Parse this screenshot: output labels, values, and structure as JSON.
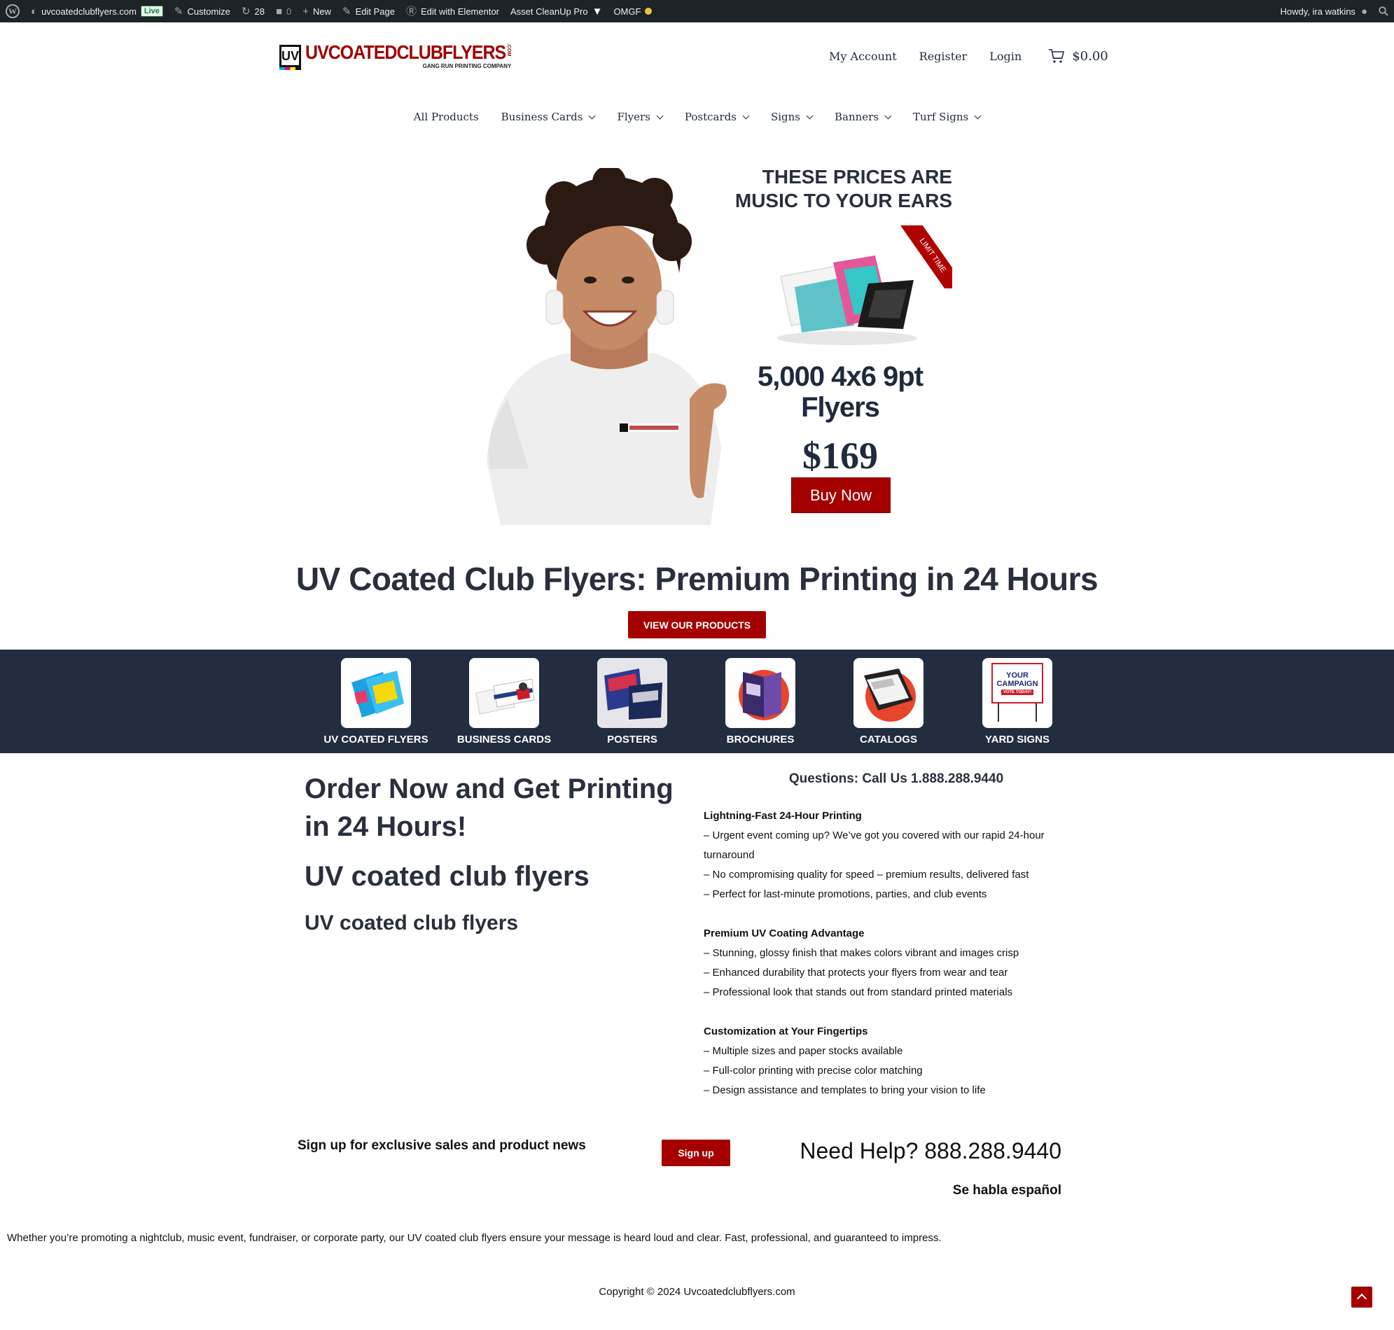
{
  "admin_bar": {
    "site_name": "uvcoatedclubflyers.com",
    "live_badge": "Live",
    "customize": "Customize",
    "updates_count": "28",
    "comments_count": "0",
    "new": "New",
    "edit_page": "Edit Page",
    "edit_elementor": "Edit with Elementor",
    "asset_cleanup": "Asset CleanUp Pro",
    "omgf": "OMGF",
    "greeting": "Howdy, ira watkins",
    "icons": [
      "wordpress-icon",
      "dashboard-icon",
      "brush-icon",
      "refresh-icon",
      "comment-icon",
      "plus-icon",
      "pencil-icon",
      "elementor-icon",
      "filter-icon",
      "user-icon",
      "search-icon"
    ]
  },
  "logo": {
    "badge": "UV",
    "main": "UVCOATEDCLUBFLYERS",
    "dotcom": ".COM",
    "tagline": "GANG RUN PRINTING COMPANY"
  },
  "top_nav": {
    "my_account": "My Account",
    "register": "Register",
    "login": "Login",
    "cart_total": "$0.00"
  },
  "main_nav": {
    "items": [
      "All Products",
      "Business Cards",
      "Flyers",
      "Postcards",
      "Signs",
      "Banners",
      "Turf Signs"
    ]
  },
  "hero": {
    "headline_1": "THESE PRICES ARE",
    "headline_2": "MUSIC TO YOUR EARS",
    "ribbon": "LIMIT TIME",
    "offer_line_1": "5,000 4x6 9pt",
    "offer_line_2": "Flyers",
    "price": "$169",
    "buy_button": "Buy Now"
  },
  "main_heading": "UV Coated Club Flyers: Premium Printing in 24 Hours",
  "view_products_button": "VIEW OUR PRODUCTS",
  "categories": [
    {
      "label": "UV COATED FLYERS"
    },
    {
      "label": "BUSINESS CARDS"
    },
    {
      "label": "POSTERS"
    },
    {
      "label": "BROCHURES"
    },
    {
      "label": "CATALOGS"
    },
    {
      "label": "YARD SIGNS",
      "sign_text_1": "YOUR",
      "sign_text_2": "CAMPAIGN",
      "sign_text_3": "VOTE TODAY!"
    }
  ],
  "left_content": {
    "heading_1": "Order Now and Get Printing in 24 Hours!",
    "heading_2": "UV coated club flyers",
    "heading_3": "UV coated club flyers"
  },
  "right_content": {
    "questions": "Questions: Call Us 1.888.288.9440",
    "sections": [
      {
        "title": "Lightning-Fast 24-Hour Printing",
        "lines": [
          "– Urgent event coming up? We’ve got you covered with our rapid 24-hour turnaround",
          "– No compromising quality for speed – premium results, delivered fast",
          "– Perfect for last-minute promotions, parties, and club events"
        ]
      },
      {
        "title": "Premium UV Coating Advantage",
        "lines": [
          "– Stunning, glossy finish that makes colors vibrant and images crisp",
          "– Enhanced durability that protects your flyers from wear and tear",
          "– Professional look that stands out from standard printed materials"
        ]
      },
      {
        "title": "Customization at Your Fingertips",
        "lines": [
          "– Multiple sizes and paper stocks available",
          "– Full-color printing with precise color matching",
          "– Design assistance and templates to bring your vision to life"
        ]
      }
    ]
  },
  "signup": {
    "text": "Sign up for exclusive sales and product news",
    "button": "Sign up"
  },
  "help": {
    "phone": "Need Help? 888.288.9440",
    "spanish": "Se habla español"
  },
  "blurb": "Whether you’re promoting a nightclub, music event, fundraiser, or corporate party, our UV coated club flyers ensure your message is heard loud and clear. Fast, professional, and guaranteed to impress.",
  "copyright": "Copyright © 2024 Uvcoatedclubflyers.com",
  "colors": {
    "brand_red": "#a50000",
    "navy": "#222d3f",
    "admin_bar": "#1d2327",
    "heading": "#2a2f3d"
  }
}
